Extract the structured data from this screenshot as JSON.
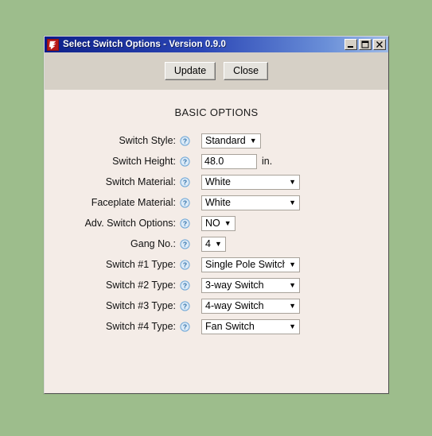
{
  "window": {
    "title": "Select Switch Options - Version 0.9.0",
    "app_icon": "app-logo-icon",
    "controls": {
      "minimize": "minimize-icon",
      "maximize": "maximize-icon",
      "close": "close-icon"
    }
  },
  "toolbar": {
    "update_label": "Update",
    "close_label": "Close"
  },
  "content": {
    "heading": "BASIC OPTIONS",
    "help_glyph": "?",
    "rows": [
      {
        "label": "Switch Style:",
        "type": "select",
        "value": "Standard",
        "width": "auto"
      },
      {
        "label": "Switch Height:",
        "type": "text",
        "value": "48.0",
        "unit": "in."
      },
      {
        "label": "Switch Material:",
        "type": "select",
        "value": "White",
        "width": "wide"
      },
      {
        "label": "Faceplate Material:",
        "type": "select",
        "value": "White",
        "width": "wide"
      },
      {
        "label": "Adv. Switch Options:",
        "type": "select",
        "value": "NO",
        "width": "auto"
      },
      {
        "label": "Gang No.:",
        "type": "select",
        "value": "4",
        "width": "auto"
      },
      {
        "label": "Switch #1 Type:",
        "type": "select",
        "value": "Single Pole Switch",
        "width": "wide"
      },
      {
        "label": "Switch #2 Type:",
        "type": "select",
        "value": "3-way Switch",
        "width": "wide"
      },
      {
        "label": "Switch #3 Type:",
        "type": "select",
        "value": "4-way Switch",
        "width": "wide"
      },
      {
        "label": "Switch #4 Type:",
        "type": "select",
        "value": "Fan Switch",
        "width": "wide"
      }
    ]
  },
  "colors": {
    "desktop": "#9dbd8c",
    "titlebar_start": "#0a1a8c",
    "titlebar_end": "#9fbbe8",
    "toolbar_bg": "#d6d0c6",
    "content_bg": "#f4ece7",
    "help_icon": "#7fb2dd",
    "app_icon": "#b81b1b"
  }
}
